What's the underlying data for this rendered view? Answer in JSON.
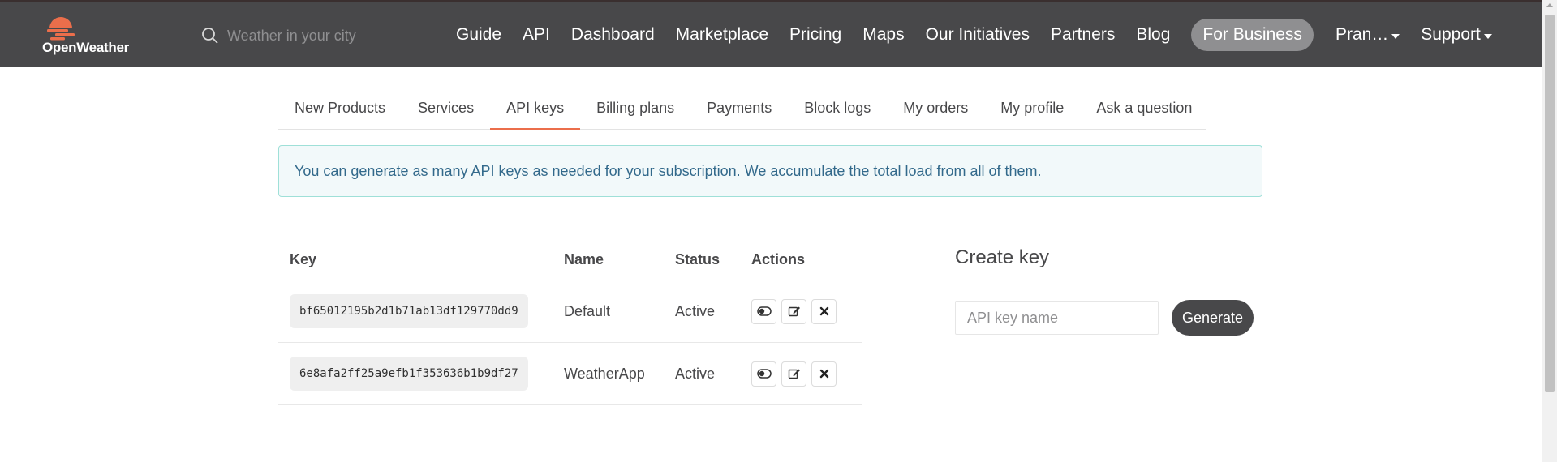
{
  "colors": {
    "header_bg": "#48484a",
    "accent": "#eb6e4b",
    "alert_bg": "#f2f9fa",
    "alert_border": "#9fe0d8",
    "alert_text": "#32698b"
  },
  "header": {
    "logo_text": "OpenWeather",
    "search": {
      "placeholder": "Weather in your city",
      "icon": "search-icon"
    },
    "nav": [
      "Guide",
      "API",
      "Dashboard",
      "Marketplace",
      "Pricing",
      "Maps",
      "Our Initiatives",
      "Partners",
      "Blog"
    ],
    "for_business": "For Business",
    "user_menu": "Pran…",
    "support_menu": "Support"
  },
  "tabs": [
    "New Products",
    "Services",
    "API keys",
    "Billing plans",
    "Payments",
    "Block logs",
    "My orders",
    "My profile",
    "Ask a question"
  ],
  "active_tab": "API keys",
  "alert": "You can generate as many API keys as needed for your subscription. We accumulate the total load from all of them.",
  "table": {
    "headers": {
      "key": "Key",
      "name": "Name",
      "status": "Status",
      "actions": "Actions"
    },
    "rows": [
      {
        "key": "bf65012195b2d1b71ab13df129770dd9",
        "name": "Default",
        "status": "Active"
      },
      {
        "key": "6e8afa2ff25a9efb1f353636b1b9df27",
        "name": "WeatherApp",
        "status": "Active"
      }
    ],
    "action_icons": [
      "toggle-icon",
      "edit-icon",
      "delete-icon"
    ]
  },
  "create_key": {
    "title": "Create key",
    "placeholder": "API key name",
    "button": "Generate"
  }
}
